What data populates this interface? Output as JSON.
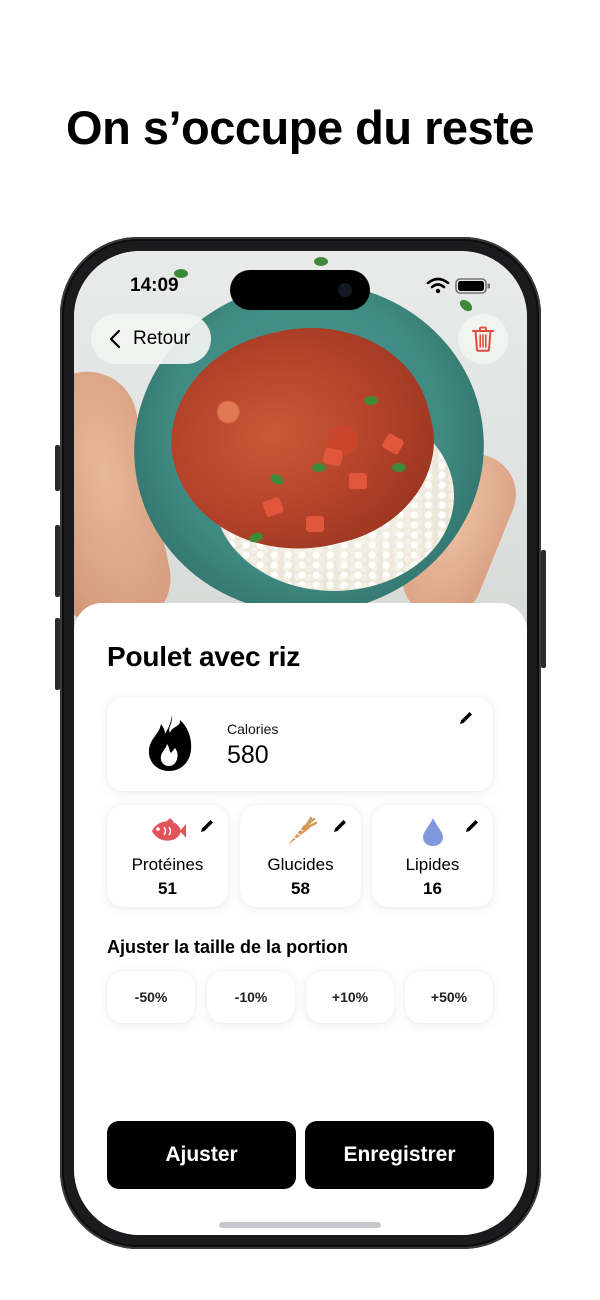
{
  "headline": "On s’occupe du reste",
  "status_bar": {
    "time": "14:09"
  },
  "nav": {
    "back_label": "Retour"
  },
  "meal": {
    "name": "Poulet avec riz"
  },
  "calories": {
    "label": "Calories",
    "value": "580",
    "icon": "flame-icon"
  },
  "macros": [
    {
      "label": "Protéines",
      "value": "51",
      "icon": "fish-icon",
      "color": "#e2545a"
    },
    {
      "label": "Glucides",
      "value": "58",
      "icon": "carrot-icon",
      "color": "#d49a58"
    },
    {
      "label": "Lipides",
      "value": "16",
      "icon": "droplet-icon",
      "color": "#7f97dc"
    }
  ],
  "portion": {
    "title": "Ajuster la taille de la portion",
    "options": [
      "-50%",
      "-10%",
      "+10%",
      "+50%"
    ]
  },
  "actions": {
    "adjust_label": "Ajuster",
    "save_label": "Enregistrer"
  },
  "colors": {
    "accent": "#000000",
    "delete": "#e24b3b"
  }
}
